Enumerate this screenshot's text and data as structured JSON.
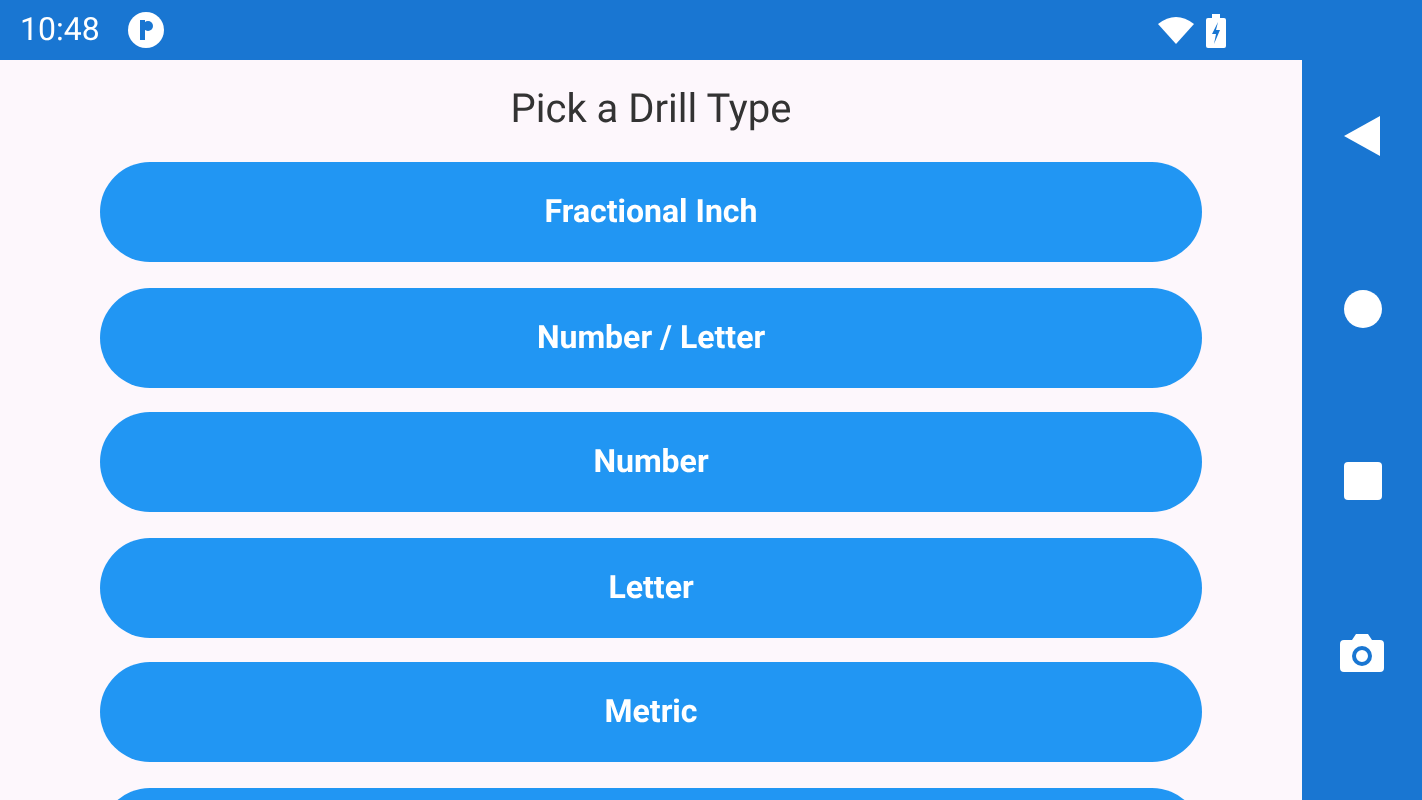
{
  "status_bar": {
    "time": "10:48"
  },
  "title": "Pick a Drill Type",
  "buttons": [
    {
      "kind": "labeled",
      "label": "Fractional Inch"
    },
    {
      "kind": "labeled",
      "label": "Number / Letter"
    },
    {
      "kind": "labeled",
      "label": "Number"
    },
    {
      "kind": "labeled",
      "label": "Letter"
    },
    {
      "kind": "labeled",
      "label": "Metric"
    },
    {
      "kind": "cut"
    }
  ]
}
